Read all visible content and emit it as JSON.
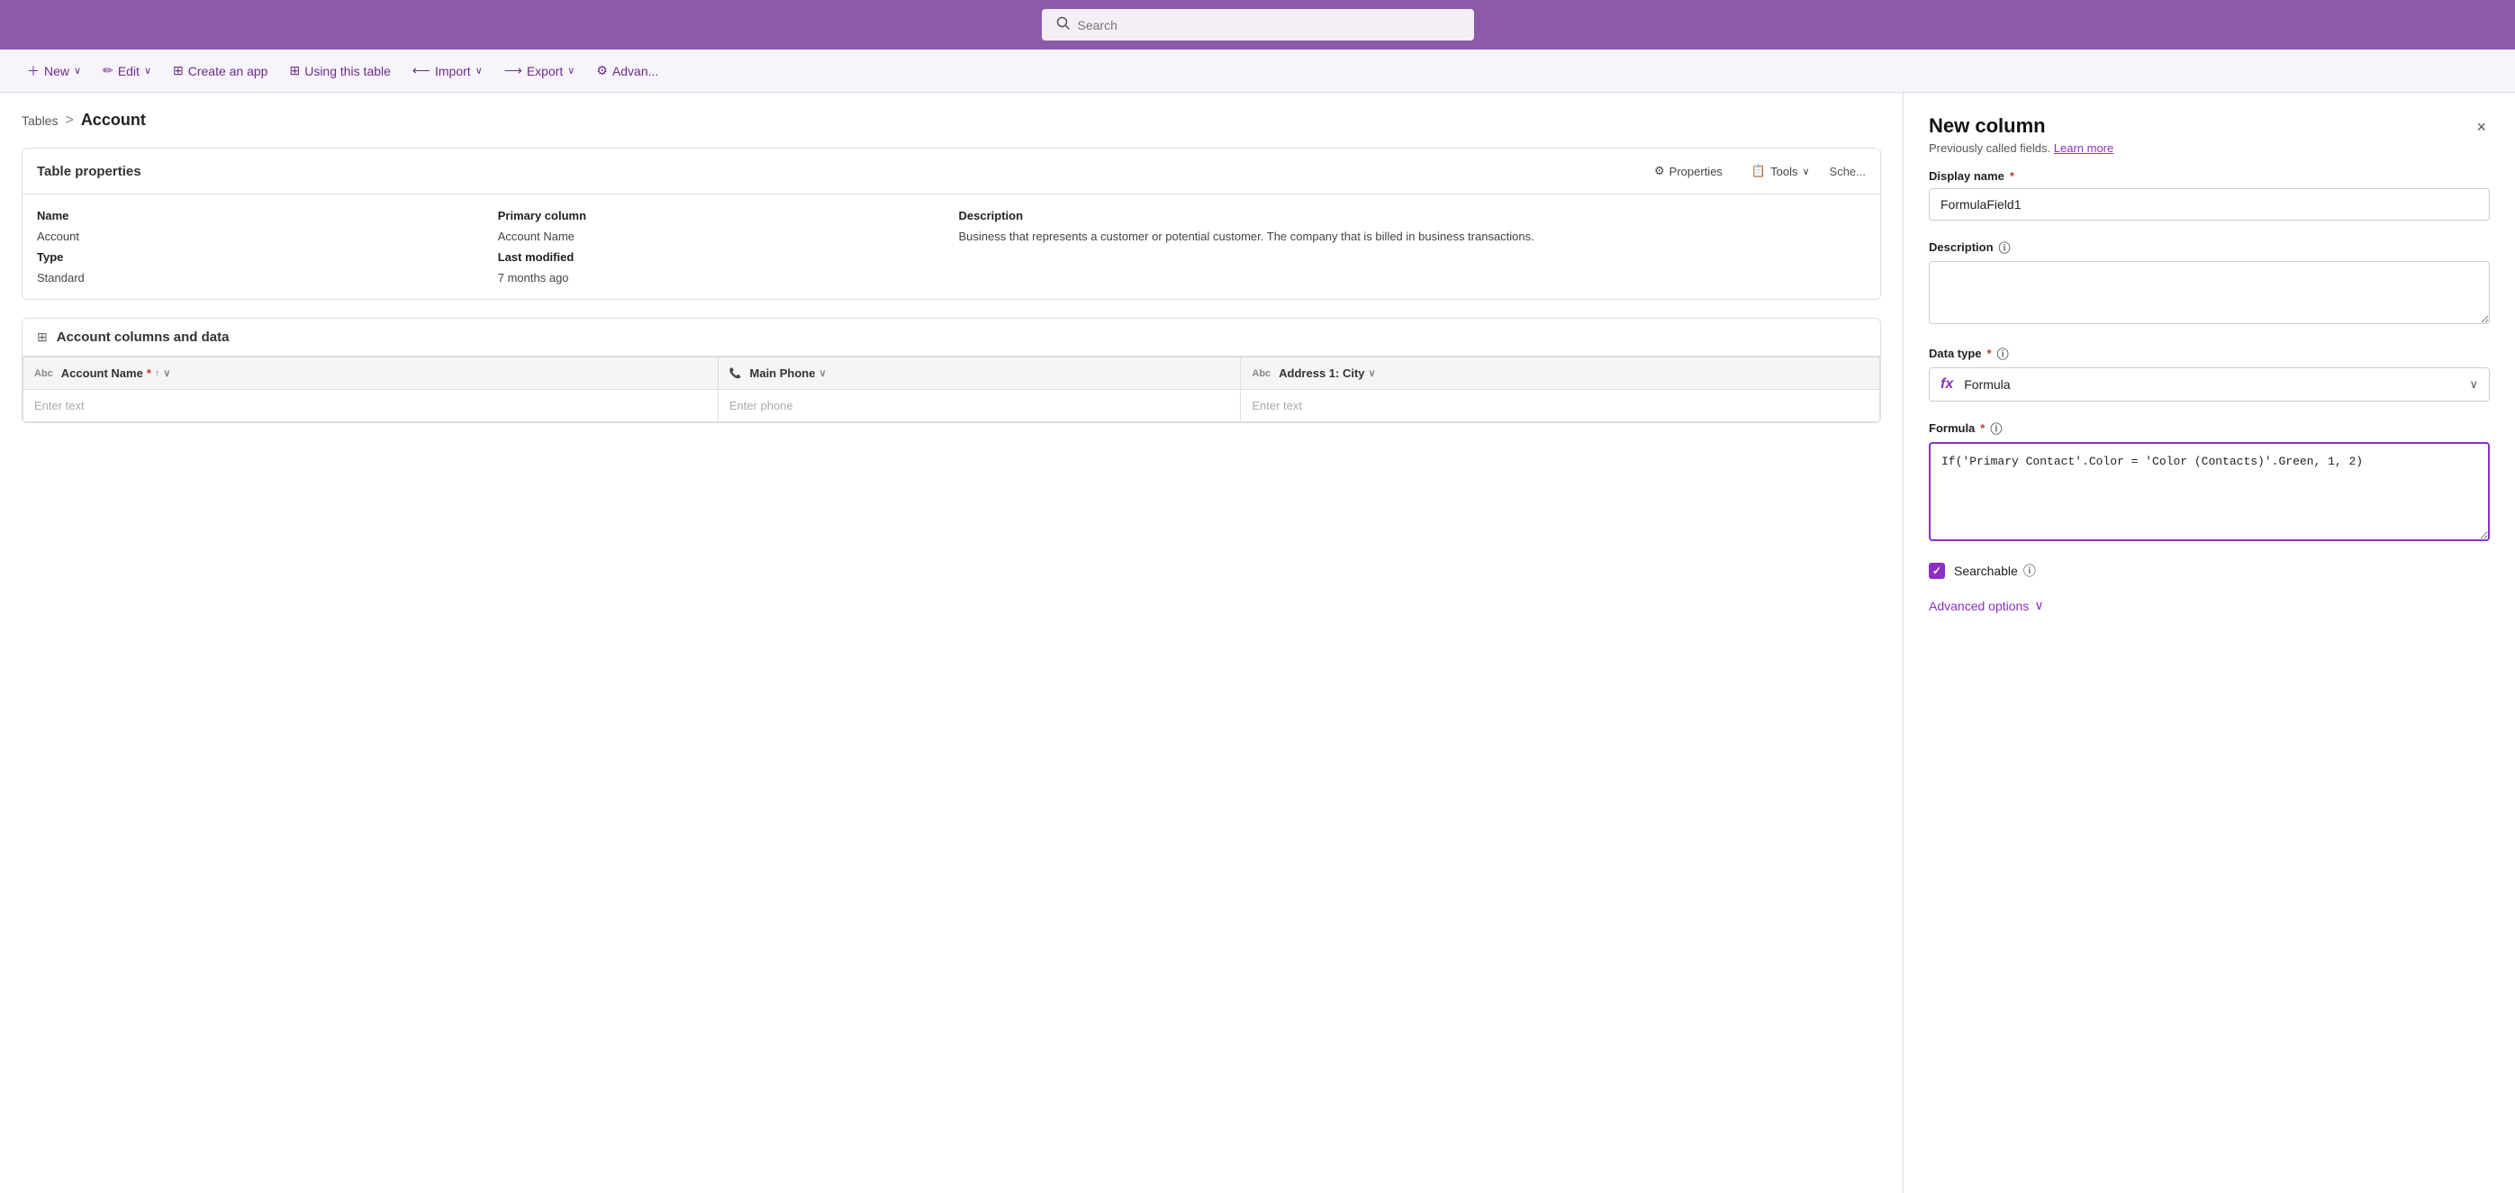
{
  "topbar": {
    "search_placeholder": "Search",
    "background_color": "#8b5ba8"
  },
  "toolbar": {
    "new_label": "New",
    "edit_label": "Edit",
    "create_app_label": "Create an app",
    "using_table_label": "Using this table",
    "import_label": "Import",
    "export_label": "Export",
    "advanced_label": "Advan..."
  },
  "breadcrumb": {
    "tables_label": "Tables",
    "separator": ">",
    "current": "Account"
  },
  "table_properties": {
    "card_title": "Table properties",
    "properties_btn": "Properties",
    "tools_btn": "Tools",
    "col_name": "Name",
    "col_primary": "Primary column",
    "col_description": "Description",
    "row_name": "Account",
    "row_primary": "Account Name",
    "row_desc": "Business that represents a customer or potential customer. The company that is billed in business transactions.",
    "row_type_label": "Type",
    "row_last_modified_label": "Last modified",
    "row_type": "Standard",
    "row_last_modified": "7 months ago"
  },
  "account_columns": {
    "card_title": "Account columns and data",
    "col1_header": "Account Name",
    "col1_icon": "Abc",
    "col1_required": true,
    "col2_header": "Main Phone",
    "col2_icon": "phone",
    "col3_header": "Address 1: City",
    "col3_icon": "Abc",
    "row1_col1": "Enter text",
    "row1_col2": "Enter phone",
    "row1_col3": "Enter text"
  },
  "side_panel": {
    "title": "New column",
    "subtitle": "Previously called fields.",
    "learn_more": "Learn more",
    "close_icon": "×",
    "display_name_label": "Display name",
    "display_name_required": "*",
    "display_name_value": "FormulaField1",
    "description_label": "Description",
    "description_info": "ⓘ",
    "description_placeholder": "",
    "data_type_label": "Data type",
    "data_type_required": "*",
    "data_type_info": "ⓘ",
    "data_type_value": "Formula",
    "data_type_icon": "fx",
    "formula_label": "Formula",
    "formula_required": "*",
    "formula_info": "ⓘ",
    "formula_value": "If('Primary Contact'.Color = 'Color (Contacts)'.Green, 1, 2)",
    "searchable_label": "Searchable",
    "searchable_info": "ⓘ",
    "searchable_checked": true,
    "advanced_options_label": "Advanced options",
    "advanced_chevron": "∨"
  }
}
